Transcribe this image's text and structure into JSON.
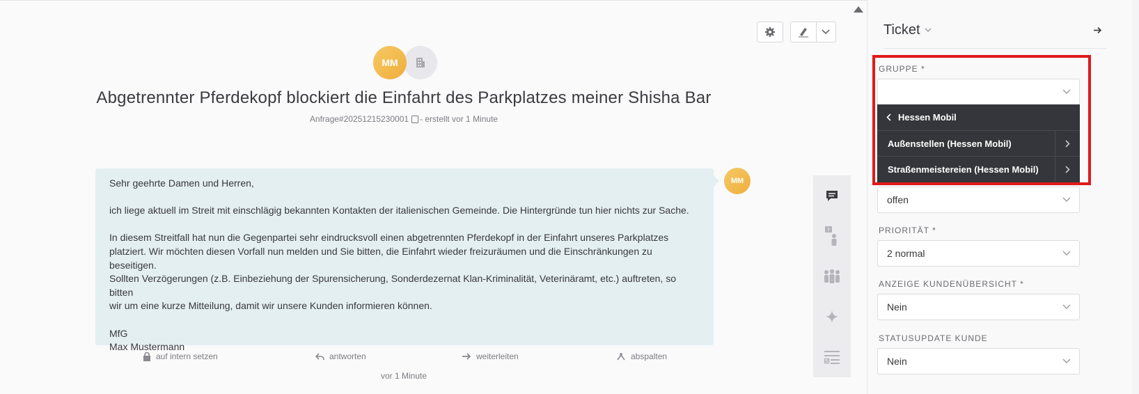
{
  "ticket": {
    "title": "Abgetrennter Pferdekopf blockiert die Einfahrt des Parkplatzes meiner Shisha Bar",
    "number": "Anfrage#20251215230001",
    "created": "- erstellt vor 1 Minute",
    "customer_initials": "MM"
  },
  "article": {
    "paragraphs": [
      "Sehr geehrte Damen und Herren,",
      "ich liege aktuell im Streit mit einschlägig bekannten Kontakten der italienischen Gemeinde. Die Hintergründe tun hier nichts zur Sache.",
      "In diesem Streitfall hat nun die Gegenpartei sehr eindrucksvoll einen abgetrennten Pferdekopf in der Einfahrt unseres Parkplatzes\nplatziert. Wir möchten diesen Vorfall nun melden und Sie bitten, die Einfahrt wieder freizuräumen und die Einschränkungen zu beseitigen.\nSollten Verzögerungen (z.B. Einbeziehung der Spurensicherung, Sonderdezernat Klan-Kriminalität, Veterinäramt, etc.) auftreten, so bitten\nwir um eine kurze Mitteilung, damit wir unsere Kunden informieren können.",
      "MfG\nMax Mustermann"
    ],
    "author_initials": "MM",
    "actions": {
      "internal": "auf intern setzen",
      "reply": "antworten",
      "forward": "weiterleiten",
      "split": "abspalten"
    },
    "timestamp": "vor 1 Minute"
  },
  "sidebar": {
    "title": "Ticket",
    "fields": {
      "group_label": "GRUPPE *",
      "group_value": "",
      "state_value": "offen",
      "priority_label": "PRIORITÄT *",
      "priority_value": "2 normal",
      "anzeige_label": "ANZEIGE KUNDENÜBERSICHT *",
      "anzeige_value": "Nein",
      "statusupdate_label": "STATUSUPDATE KUNDE",
      "statusupdate_value": "Nein"
    },
    "dropdown": {
      "back_label": "Hessen Mobil",
      "items": [
        "Außenstellen (Hessen Mobil)",
        "Straßenmeistereien (Hessen Mobil)"
      ]
    }
  },
  "colors": {
    "highlight": "#e01a1a",
    "dropdown_bg": "#34363c",
    "avatar": "#f0ae3b",
    "article_bg": "#e4eff2"
  }
}
